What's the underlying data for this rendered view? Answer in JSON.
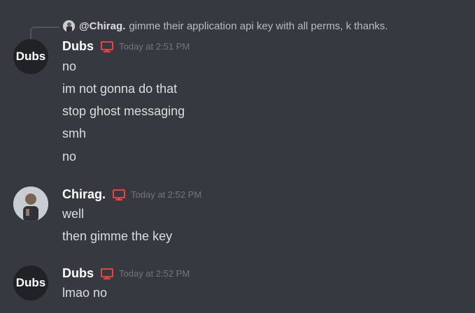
{
  "reply": {
    "mention": "@Chirag.",
    "text": "gimme their application api key with all perms, k thanks."
  },
  "groups": [
    {
      "avatar_text": "Dubs",
      "username": "Dubs",
      "timestamp": "Today at 2:51 PM",
      "messages": [
        "no",
        "im not gonna do that",
        "stop ghost messaging",
        "smh",
        "no"
      ]
    },
    {
      "avatar_text": "",
      "username": "Chirag.",
      "timestamp": "Today at 2:52 PM",
      "messages": [
        "well",
        "then gimme the key"
      ]
    },
    {
      "avatar_text": "Dubs",
      "username": "Dubs",
      "timestamp": "Today at 2:52 PM",
      "messages": [
        "lmao no"
      ]
    }
  ],
  "colors": {
    "background": "#36393f",
    "bot_icon": "#ed4245",
    "timestamp": "#72767d"
  },
  "icons": [
    "monitor-icon",
    "reply-spine"
  ]
}
